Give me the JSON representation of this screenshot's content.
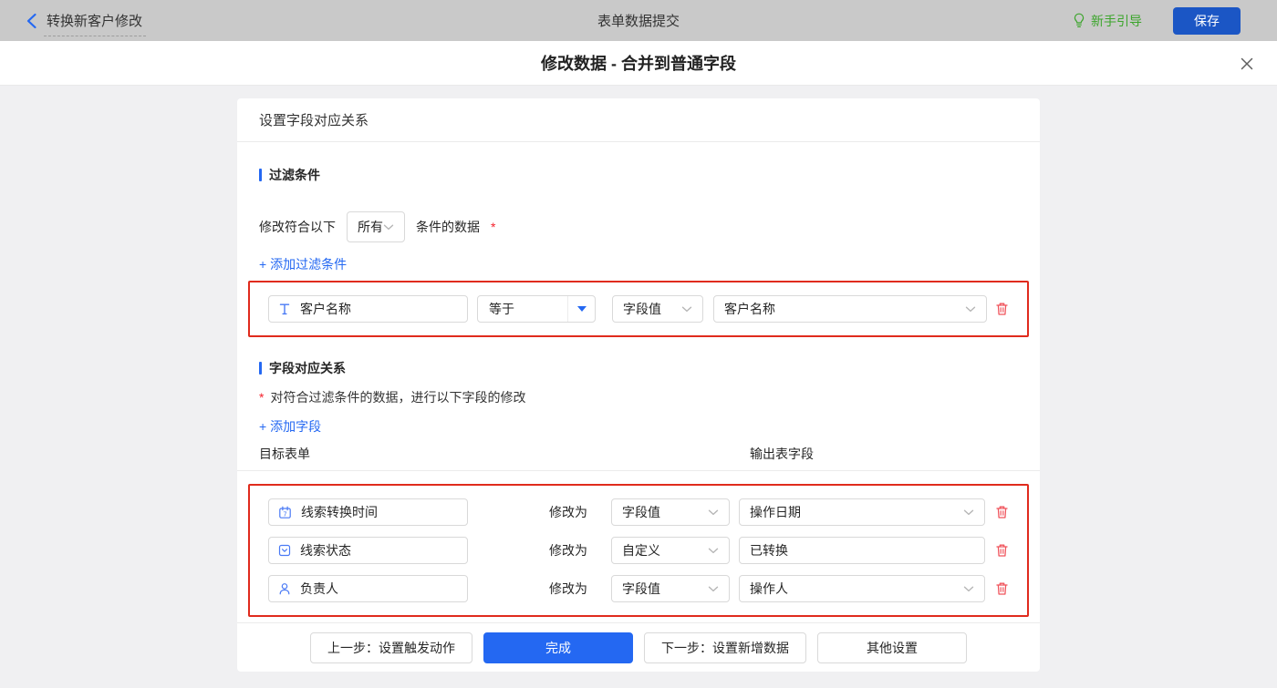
{
  "colors": {
    "topbar_gray": "#c9c9c9",
    "primary_blue": "#2468f2",
    "save_button_blue": "#1b56c5",
    "guide_green": "#3ca52c",
    "highlight_box_red": "#e02b1d",
    "trash_red": "#f0545c",
    "asterisk_red": "#f5222d",
    "field_icon_blue": "#4a7af5"
  },
  "topbar": {
    "back_label": "转换新客户修改",
    "title": "表单数据提交",
    "guide_label": "新手引导",
    "save_label": "保存"
  },
  "dialog": {
    "title": "修改数据 - 合并到普通字段"
  },
  "panel": {
    "title": "设置字段对应关系",
    "filter": {
      "heading": "过滤条件",
      "condition_prefix": "修改符合以下",
      "match_mode": "所有",
      "condition_suffix": "条件的数据",
      "required_mark": "*",
      "add_link": "+ 添加过滤条件",
      "row": {
        "field": "客户名称",
        "field_icon": "text-field-icon",
        "operator": "等于",
        "value_type": "字段值",
        "value": "客户名称"
      }
    },
    "mapping": {
      "heading": "字段对应关系",
      "required_mark": "*",
      "description": "对符合过滤条件的数据，进行以下字段的修改",
      "add_link": "+ 添加字段",
      "columns": {
        "target": "目标表单",
        "output": "输出表字段"
      },
      "modify_label": "修改为",
      "rows": [
        {
          "field": "线索转换时间",
          "field_icon": "calendar-icon",
          "type": "字段值",
          "value": "操作日期"
        },
        {
          "field": "线索状态",
          "field_icon": "select-field-icon",
          "type": "自定义",
          "value": "已转换"
        },
        {
          "field": "负责人",
          "field_icon": "person-icon",
          "type": "字段值",
          "value": "操作人"
        }
      ]
    },
    "footer": {
      "prev_label": "上一步：设置触发动作",
      "done_label": "完成",
      "next_label": "下一步：设置新增数据",
      "other_label": "其他设置"
    }
  }
}
